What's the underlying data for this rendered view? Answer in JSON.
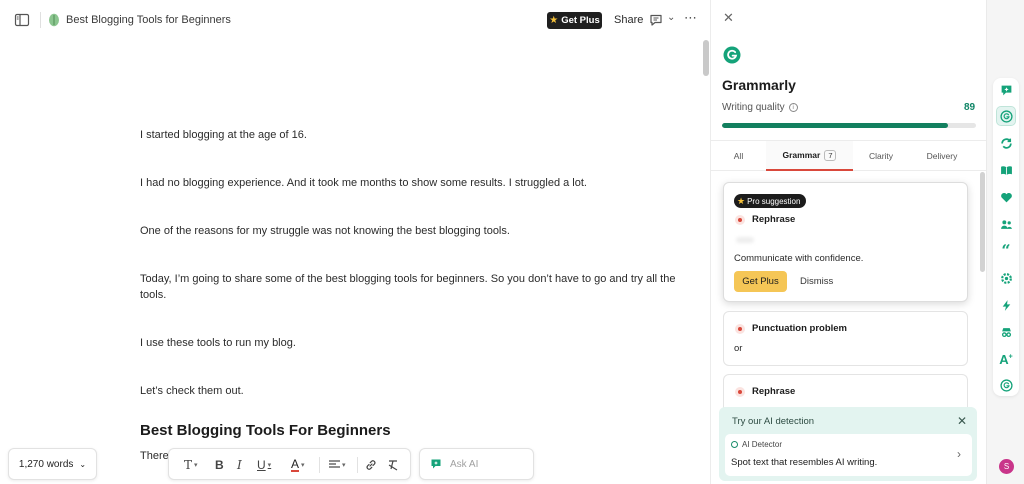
{
  "header": {
    "doc_title": "Best Blogging Tools for Beginners",
    "get_plus": "Get Plus",
    "share": "Share"
  },
  "document": {
    "paragraphs": [
      "I started blogging at the age of 16.",
      "I had no blogging experience. And it took me months to show some results. I struggled a lot.",
      "One of the reasons for my struggle was not knowing the best blogging tools.",
      "Today, I’m going to share some of the best blogging tools for beginners. So you don’t have to go and try all the tools.",
      "I use these tools to run my blog.",
      "Let’s check them out."
    ],
    "heading": "Best Blogging Tools For Beginners",
    "partial_text": "There"
  },
  "bottom": {
    "word_count": "1,270 words",
    "ask_ai_placeholder": "Ask AI"
  },
  "grammarly": {
    "title": "Grammarly",
    "writing_quality_label": "Writing quality",
    "score": "89",
    "score_fraction": 0.89,
    "tabs": [
      {
        "label": "All"
      },
      {
        "label": "Grammar",
        "count": "7"
      },
      {
        "label": "Clarity"
      },
      {
        "label": "Delivery"
      }
    ],
    "pro_card": {
      "badge": "Pro suggestion",
      "title": "Rephrase",
      "description": "Communicate with confidence.",
      "primary_button": "Get Plus",
      "secondary_button": "Dismiss"
    },
    "punct_card": {
      "title": "Punctuation problem",
      "text": "or"
    },
    "rephrase_card": {
      "title": "Rephrase"
    },
    "ai_detection": {
      "title": "Try our AI detection",
      "label": "AI Detector",
      "text": "Spot text that resembles AI writing."
    }
  },
  "rail": {
    "avatar_initial": "S",
    "accent": "#15a37a"
  },
  "colors": {
    "brand_green": "#13805f",
    "tab_active_underline": "#d9483b",
    "get_plus_button": "#f5c656"
  }
}
